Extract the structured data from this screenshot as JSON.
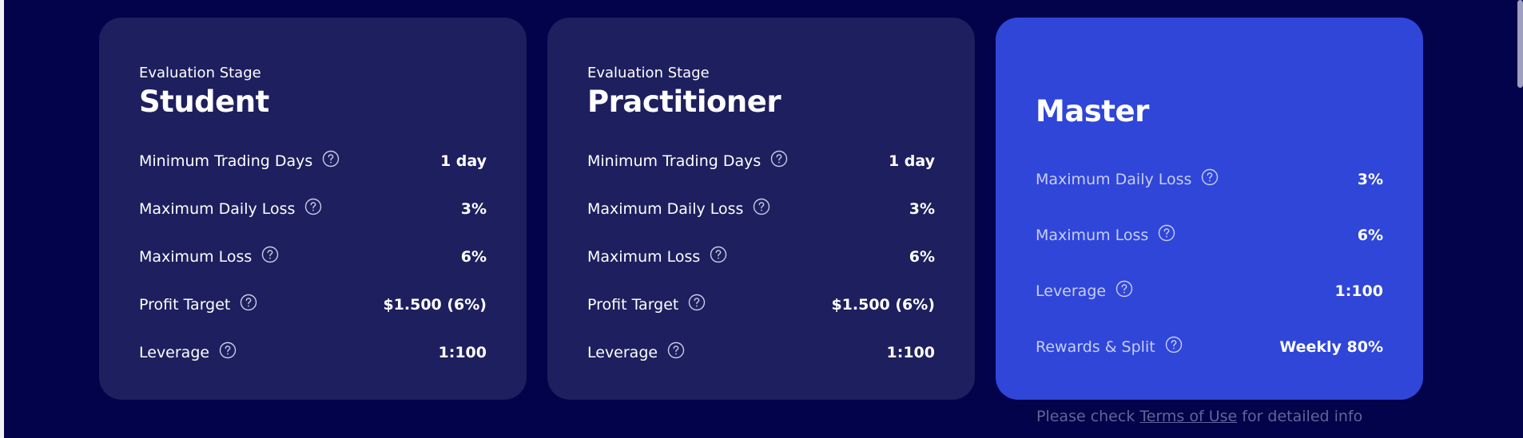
{
  "cards": [
    {
      "stage": "Evaluation Stage",
      "title": "Student",
      "rows": [
        {
          "label": "Minimum Trading Days",
          "value": "1 day"
        },
        {
          "label": "Maximum Daily Loss",
          "value": "3%"
        },
        {
          "label": "Maximum Loss",
          "value": "6%"
        },
        {
          "label": "Profit Target",
          "value": "$1.500 (6%)"
        },
        {
          "label": "Leverage",
          "value": "1:100"
        }
      ]
    },
    {
      "stage": "Evaluation Stage",
      "title": "Practitioner",
      "rows": [
        {
          "label": "Minimum Trading Days",
          "value": "1 day"
        },
        {
          "label": "Maximum Daily Loss",
          "value": "3%"
        },
        {
          "label": "Maximum Loss",
          "value": "6%"
        },
        {
          "label": "Profit Target",
          "value": "$1.500 (6%)"
        },
        {
          "label": "Leverage",
          "value": "1:100"
        }
      ]
    },
    {
      "title": "Master",
      "rows": [
        {
          "label": "Maximum Daily Loss",
          "value": "3%"
        },
        {
          "label": "Maximum Loss",
          "value": "6%"
        },
        {
          "label": "Leverage",
          "value": "1:100"
        },
        {
          "label": "Rewards & Split",
          "value": "Weekly 80%"
        }
      ]
    }
  ],
  "footnote": {
    "prefix": "Please check ",
    "link": "Terms of Use",
    "suffix": " for detailed info"
  },
  "icons": {
    "help": "question-circle-icon"
  },
  "colors": {
    "background": "#02034a",
    "card": "#1d1f5e",
    "highlight_card": "#2f46d9",
    "muted_text": "#5f6599"
  }
}
